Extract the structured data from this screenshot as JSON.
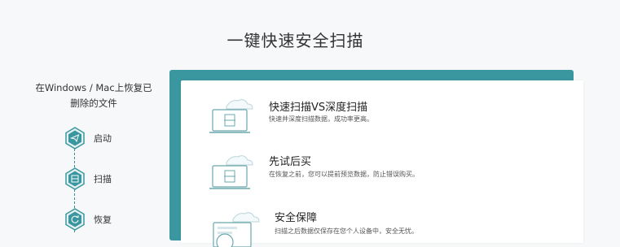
{
  "page": {
    "title": "一键快速安全扫描"
  },
  "sidebar": {
    "title_line1": "在Windows / Mac上恢复已",
    "title_line2": "删除的文件",
    "steps": [
      {
        "label": "启动",
        "icon": "send-icon"
      },
      {
        "label": "扫描",
        "icon": "scan-icon"
      },
      {
        "label": "恢复",
        "icon": "restore-icon"
      }
    ]
  },
  "features": [
    {
      "title": "快速扫描VS深度扫描",
      "desc": "快速并深度扫描数据，成功率更高。",
      "icon": "laptop-scan-icon"
    },
    {
      "title": "先试后买",
      "desc": "在恢复之前，您可以提前预览数据，防止错误购买。",
      "icon": "laptop-preview-icon"
    },
    {
      "title": "安全保障",
      "desc": "扫描之后数据仅保存在您个人设备中，安全无忧。",
      "icon": "shield-device-icon"
    }
  ],
  "colors": {
    "accent": "#3a979f",
    "background": "#f6f8f9",
    "panel": "#ffffff"
  }
}
